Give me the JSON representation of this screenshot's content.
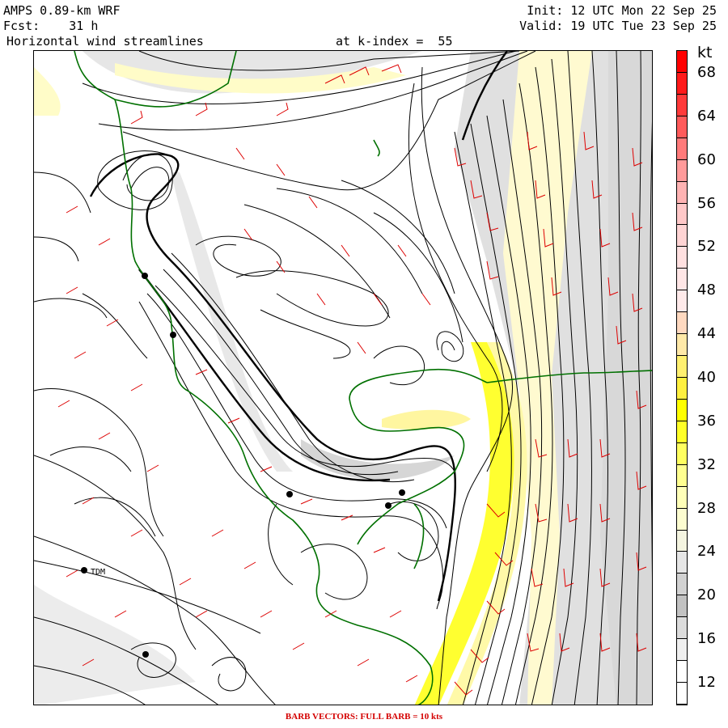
{
  "header": {
    "model": "AMPS 0.89-km WRF",
    "forecast": "Fcst:    31 h",
    "field": "Horizontal wind streamlines",
    "level": "at k-index =  55",
    "init": "Init: 12 UTC Mon 22 Sep 25",
    "valid": "Valid: 19 UTC Tue 23 Sep 25"
  },
  "colorbar": {
    "unit": "kt",
    "ticks": [
      "68",
      "64",
      "60",
      "56",
      "52",
      "48",
      "44",
      "40",
      "36",
      "32",
      "28",
      "24",
      "20",
      "16",
      "12"
    ],
    "segments": [
      "#ff0000",
      "#ff1a1a",
      "#ff3a3a",
      "#ff5a5a",
      "#ff7a7a",
      "#ff9a9a",
      "#ffb3b3",
      "#ffc8c8",
      "#ffd4d4",
      "#ffe0e0",
      "#ffe6e6",
      "#ffeaea",
      "#ffd9c0",
      "#ffe9a8",
      "#fff070",
      "#fff040",
      "#ffff00",
      "#ffff28",
      "#ffff60",
      "#ffff90",
      "#ffffb8",
      "#fcfcd0",
      "#f4f4e0",
      "#e6e6e6",
      "#d2d2d2",
      "#c2c2c2",
      "#dcdcdc",
      "#efefef",
      "#ffffff",
      "#ffffff"
    ]
  },
  "map": {
    "station_label": "TDM",
    "colors": {
      "streamline": "#000000",
      "coast": "#007000",
      "barb": "#dd0000",
      "shade_light": "#e4e4e4",
      "shade_mid": "#c8c8c8",
      "yellow": "#ffff40",
      "pale": "#fffcc8"
    }
  },
  "footer": "BARB VECTORS:  FULL BARB = 10 kts"
}
